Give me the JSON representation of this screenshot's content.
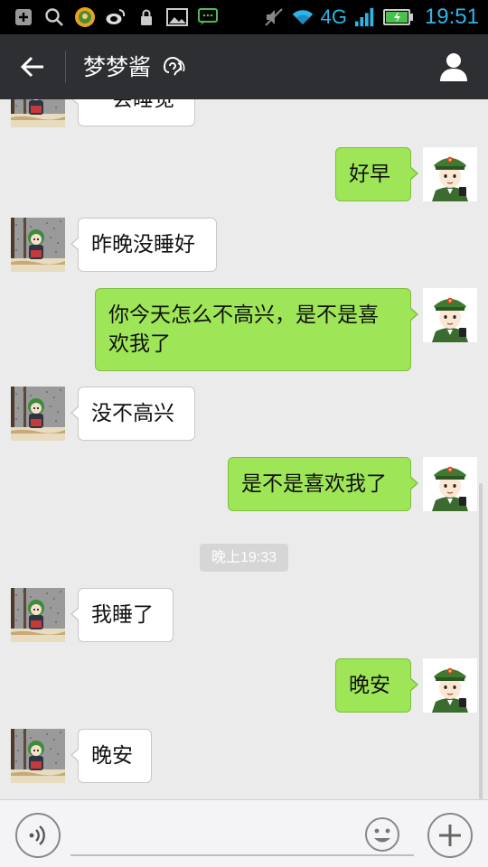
{
  "status_bar": {
    "network": "4G",
    "time": "19:51",
    "left_icons": [
      "add-notification-icon",
      "search-icon",
      "game-icon",
      "weibo-icon",
      "lock-icon",
      "image-icon",
      "chat-icon"
    ],
    "right_icons": [
      "mute-icon",
      "wifi-icon",
      "signal-icon",
      "battery-icon"
    ]
  },
  "header": {
    "title": "梦梦酱",
    "back_icon": "arrow-left-icon",
    "ear_icon": "earpiece-mode-icon",
    "profile_icon": "person-icon"
  },
  "chat": {
    "messages": [
      {
        "side": "left",
        "text": "一会睡觉"
      },
      {
        "side": "right",
        "text": "好早"
      },
      {
        "side": "left",
        "text": "昨晚没睡好"
      },
      {
        "side": "right",
        "text": "你今天怎么不高兴，是不是喜欢我了"
      },
      {
        "side": "left",
        "text": "没不高兴"
      },
      {
        "side": "right",
        "text": "是不是喜欢我了"
      },
      {
        "side": "left",
        "text": "我睡了"
      },
      {
        "side": "right",
        "text": "晚安"
      },
      {
        "side": "left",
        "text": "晚安"
      }
    ],
    "timestamp": "晚上19:33"
  },
  "input_bar": {
    "voice_icon": "voice-input-icon",
    "emoji_icon": "emoji-icon",
    "plus_icon": "plus-icon",
    "text_value": ""
  },
  "colors": {
    "header_bg": "#2d2f32",
    "chat_bg": "#ebebeb",
    "out_bubble": "#9ee657",
    "in_bubble": "#ffffff",
    "status_accent": "#2fb5e8"
  }
}
